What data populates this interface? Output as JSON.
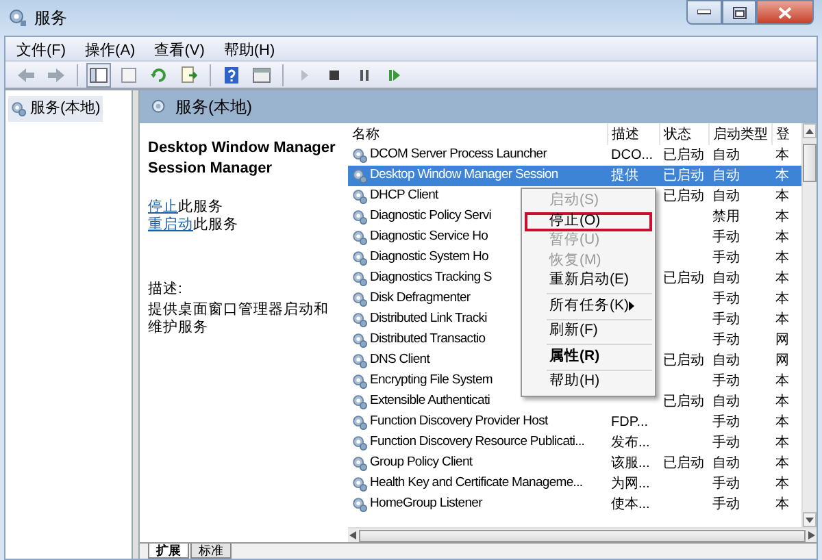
{
  "window": {
    "title": "服务"
  },
  "menu_bar": [
    "文件(F)",
    "操作(A)",
    "查看(V)",
    "帮助(H)"
  ],
  "tree": [
    {
      "label": "服务(本地)",
      "selected": true
    }
  ],
  "pane_header": "服务(本地)",
  "details": {
    "title": "Desktop Window Manager Session Manager",
    "actions": [
      {
        "link": "停止",
        "text": "此服务"
      },
      {
        "link": "重启动",
        "text": "此服务"
      }
    ],
    "description_label": "描述:",
    "description": "提供桌面窗口管理器启动和维护服务"
  },
  "table": {
    "columns": [
      "名称",
      "描述",
      "状态",
      "启动类型",
      "登"
    ],
    "rows": [
      {
        "name": "DCOM Server Process Launcher",
        "description": "DCO...",
        "status": "已启动",
        "startup": "自动",
        "logon": "本",
        "selected": false
      },
      {
        "name": "Desktop Window Manager Session",
        "description": "提供",
        "status": "已启动",
        "startup": "自动",
        "logon": "本",
        "selected": true
      },
      {
        "name": "DHCP Client",
        "description": "",
        "status": "已启动",
        "startup": "自动",
        "logon": "本",
        "selected": false
      },
      {
        "name": "Diagnostic Policy Servi",
        "description": "",
        "status": "",
        "startup": "禁用",
        "logon": "本",
        "selected": false
      },
      {
        "name": "Diagnostic Service Ho",
        "description": "",
        "status": "",
        "startup": "手动",
        "logon": "本",
        "selected": false
      },
      {
        "name": "Diagnostic System Ho",
        "description": "",
        "status": "",
        "startup": "手动",
        "logon": "本",
        "selected": false
      },
      {
        "name": "Diagnostics Tracking S",
        "description": "",
        "status": "已启动",
        "startup": "自动",
        "logon": "本",
        "selected": false
      },
      {
        "name": "Disk Defragmenter",
        "description": "",
        "status": "",
        "startup": "手动",
        "logon": "本",
        "selected": false
      },
      {
        "name": "Distributed Link Tracki",
        "description": "",
        "status": "",
        "startup": "手动",
        "logon": "本",
        "selected": false
      },
      {
        "name": "Distributed Transactio",
        "description": "",
        "status": "",
        "startup": "手动",
        "logon": "网",
        "selected": false
      },
      {
        "name": "DNS Client",
        "description": "",
        "status": "已启动",
        "startup": "自动",
        "logon": "网",
        "selected": false
      },
      {
        "name": "Encrypting File System",
        "description": "",
        "status": "",
        "startup": "手动",
        "logon": "本",
        "selected": false
      },
      {
        "name": "Extensible Authenticati",
        "description": "",
        "status": "已启动",
        "startup": "自动",
        "logon": "本",
        "selected": false
      },
      {
        "name": "Function Discovery Provider Host",
        "description": "FDP...",
        "status": "",
        "startup": "手动",
        "logon": "本",
        "selected": false
      },
      {
        "name": "Function Discovery Resource Publicati...",
        "description": "发布...",
        "status": "",
        "startup": "手动",
        "logon": "本",
        "selected": false
      },
      {
        "name": "Group Policy Client",
        "description": "该服...",
        "status": "已启动",
        "startup": "自动",
        "logon": "本",
        "selected": false
      },
      {
        "name": "Health Key and Certificate Manageme...",
        "description": "为网...",
        "status": "",
        "startup": "手动",
        "logon": "本",
        "selected": false
      },
      {
        "name": "HomeGroup Listener",
        "description": "使本...",
        "status": "",
        "startup": "手动",
        "logon": "本",
        "selected": false
      }
    ]
  },
  "context_menu": [
    {
      "kind": "item",
      "label": "启动(S)",
      "disabled": true,
      "highlighted": false
    },
    {
      "kind": "item",
      "label": "停止(O)",
      "disabled": false,
      "highlighted": true
    },
    {
      "kind": "item",
      "label": "暂停(U)",
      "disabled": true,
      "highlighted": false
    },
    {
      "kind": "item",
      "label": "恢复(M)",
      "disabled": true,
      "highlighted": false
    },
    {
      "kind": "item",
      "label": "重新启动(E)",
      "disabled": false,
      "highlighted": false
    },
    {
      "kind": "separator"
    },
    {
      "kind": "submenu",
      "label": "所有任务(K)",
      "disabled": false,
      "highlighted": false
    },
    {
      "kind": "separator"
    },
    {
      "kind": "item",
      "label": "刷新(F)",
      "disabled": false,
      "highlighted": false
    },
    {
      "kind": "separator"
    },
    {
      "kind": "default",
      "label": "属性(R)",
      "disabled": false,
      "highlighted": false
    },
    {
      "kind": "separator"
    },
    {
      "kind": "item",
      "label": "帮助(H)",
      "disabled": false,
      "highlighted": false
    }
  ],
  "bottom_tabs": [
    {
      "label": "扩展",
      "selected": true
    },
    {
      "label": "标准",
      "selected": false
    }
  ]
}
